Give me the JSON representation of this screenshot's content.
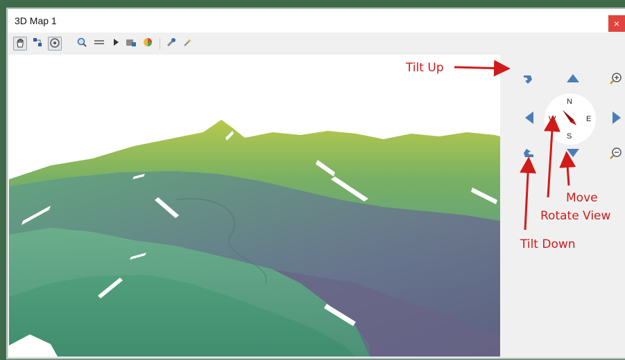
{
  "window": {
    "title": "3D Map 1",
    "close_glyph": "×"
  },
  "toolbar": {
    "icons": [
      "pan-hand-icon",
      "identify-icon",
      "camera-rotate-icon",
      "zoom-full-icon",
      "measure-line-icon",
      "play-animation-icon",
      "save-image-icon",
      "map-themes-icon",
      "options-icon",
      "effects-icon"
    ]
  },
  "navigation": {
    "compass": {
      "n": "N",
      "s": "S",
      "e": "E",
      "w": "W"
    }
  },
  "annotations": {
    "tilt_up": "Tilt Up",
    "tilt_down": "Tilt Down",
    "move": "Move",
    "rotate_view": "Rotate View"
  },
  "colors": {
    "annotation": "#d11a1a",
    "nav_blue": "#4a7db8",
    "close_red": "#e0443d"
  }
}
